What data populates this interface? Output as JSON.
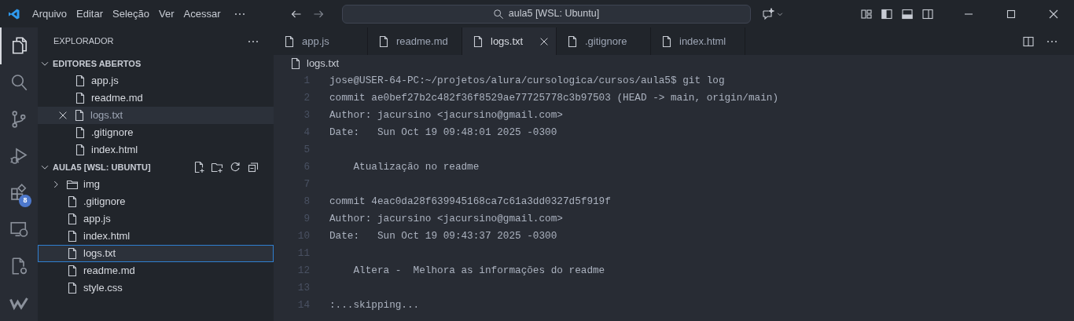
{
  "titlebar": {
    "menu": [
      "Arquivo",
      "Editar",
      "Seleção",
      "Ver",
      "Acessar"
    ],
    "command_center": "aula5 [WSL: Ubuntu]"
  },
  "activity_bar": {
    "items": [
      {
        "kind": "explorer",
        "selected": true
      },
      {
        "kind": "search",
        "selected": false
      },
      {
        "kind": "source-control",
        "selected": false
      },
      {
        "kind": "run",
        "selected": false
      },
      {
        "kind": "extensions",
        "selected": false,
        "badge": "8"
      },
      {
        "kind": "remote",
        "selected": false
      },
      {
        "kind": "cpp",
        "selected": false
      },
      {
        "kind": "w",
        "selected": false
      }
    ]
  },
  "sidebar": {
    "title": "EXPLORADOR",
    "sections": [
      {
        "title": "EDITORES ABERTOS",
        "expanded": true,
        "items": [
          {
            "name": "app.js",
            "kind": "file",
            "selected": false
          },
          {
            "name": "readme.md",
            "kind": "file",
            "selected": false
          },
          {
            "name": "logs.txt",
            "kind": "file",
            "selected": true
          },
          {
            "name": ".gitignore",
            "kind": "file",
            "selected": false
          },
          {
            "name": "index.html",
            "kind": "file",
            "selected": false
          }
        ]
      },
      {
        "title": "AULA5 [WSL: UBUNTU]",
        "expanded": true,
        "items": [
          {
            "name": "img",
            "kind": "folder",
            "expanded": false,
            "selected": false
          },
          {
            "name": ".gitignore",
            "kind": "file",
            "selected": false
          },
          {
            "name": "app.js",
            "kind": "file",
            "selected": false
          },
          {
            "name": "index.html",
            "kind": "file",
            "selected": false
          },
          {
            "name": "logs.txt",
            "kind": "file",
            "selected": true
          },
          {
            "name": "readme.md",
            "kind": "file",
            "selected": false
          },
          {
            "name": "style.css",
            "kind": "file",
            "selected": false
          }
        ]
      }
    ]
  },
  "tabs": [
    {
      "label": "app.js",
      "selected": false
    },
    {
      "label": "readme.md",
      "selected": false
    },
    {
      "label": "logs.txt",
      "selected": true
    },
    {
      "label": ".gitignore",
      "selected": false
    },
    {
      "label": "index.html",
      "selected": false
    }
  ],
  "breadcrumb": "logs.txt",
  "lines": [
    {
      "number": "1",
      "text": "jose@USER-64-PC:~/projetos/alura/cursologica/cursos/aula5$ git log"
    },
    {
      "number": "2",
      "text": "commit ae0bef27b2c482f36f8529ae77725778c3b97503 (HEAD -> main, origin/main)"
    },
    {
      "number": "3",
      "text": "Author: jacursino <jacursino@gmail.com>"
    },
    {
      "number": "4",
      "text": "Date:   Sun Oct 19 09:48:01 2025 -0300"
    },
    {
      "number": "5"
    },
    {
      "number": "6",
      "text": "    Atualização no readme"
    },
    {
      "number": "7"
    },
    {
      "number": "8",
      "text": "commit 4eac0da28f639945168ca7c61a3dd0327d5f919f"
    },
    {
      "number": "9",
      "text": "Author: jacursino <jacursino@gmail.com>"
    },
    {
      "number": "10",
      "text": "Date:   Sun Oct 19 09:43:37 2025 -0300"
    },
    {
      "number": "11"
    },
    {
      "number": "12",
      "text": "    Altera -  Melhora as informações do readme"
    },
    {
      "number": "13"
    },
    {
      "number": "14",
      "text": ":...skipping..."
    }
  ]
}
